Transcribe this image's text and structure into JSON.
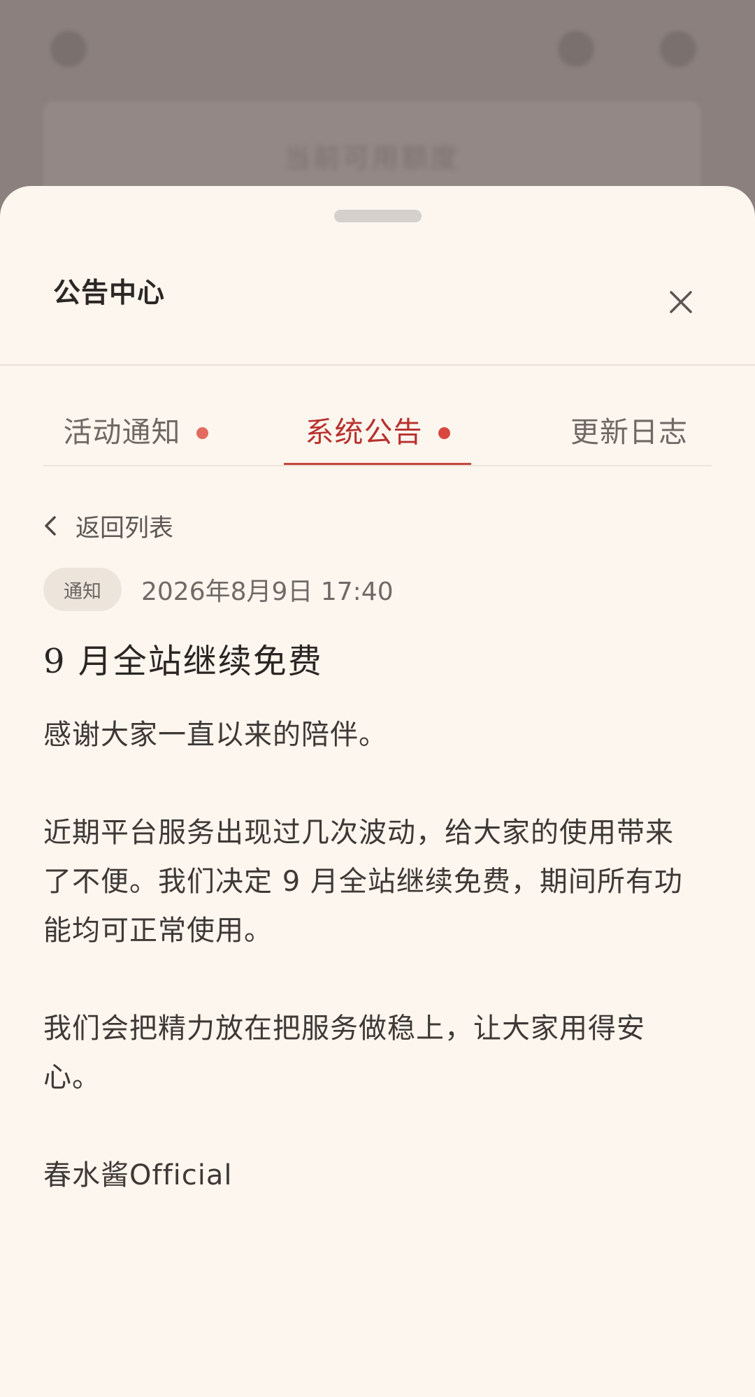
{
  "background": {
    "banner_text": "当前可用额度"
  },
  "sheet": {
    "title": "公告中心",
    "close_label": "关闭"
  },
  "tabs": [
    {
      "label": "活动通知",
      "has_dot": true,
      "active": false
    },
    {
      "label": "系统公告",
      "has_dot": true,
      "active": true
    },
    {
      "label": "更新日志",
      "has_dot": false,
      "active": false
    }
  ],
  "back": {
    "label": "返回列表"
  },
  "notice": {
    "badge": "通知",
    "date": "2026年8月9日 17:40",
    "title": "9 月全站继续免费",
    "paragraphs": [
      "感谢大家一直以来的陪伴。",
      "近期平台服务出现过几次波动，给大家的使用带来了不便。我们决定 9 月全站继续免费，期间所有功能均可正常使用。",
      "我们会把精力放在把服务做稳上，让大家用得安心。",
      "春水酱Official"
    ]
  },
  "colors": {
    "accent": "#b8312f",
    "dot": "#e26a60",
    "sheet_bg": "#fcf6ee"
  }
}
